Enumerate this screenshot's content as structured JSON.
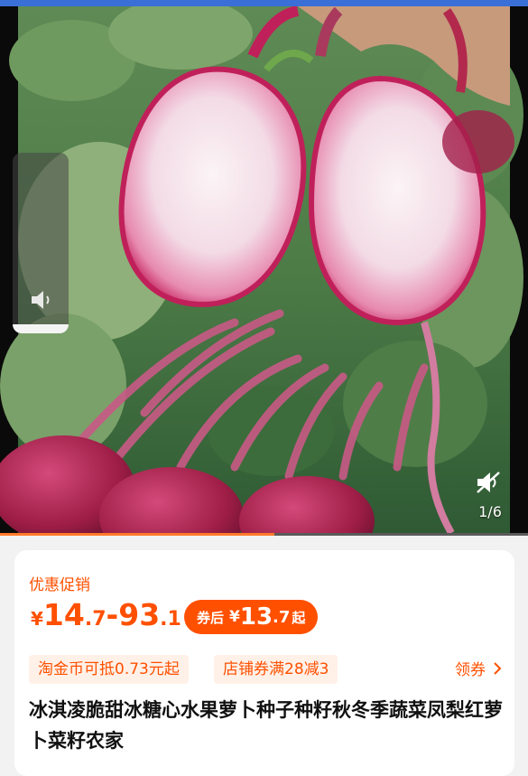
{
  "media": {
    "page_indicator": "1/6",
    "volume_level": 0.05,
    "progress": 0.52,
    "icons": [
      "speaker-icon",
      "mute-icon"
    ],
    "colors": {
      "radish": "#c7265f",
      "flesh": "#f6eaf0",
      "leaf": "#3e8a45"
    }
  },
  "promo": {
    "label": "优惠促销",
    "price": {
      "currency": "¥",
      "low_int": "14",
      "low_dec": ".7",
      "dash": "-",
      "high_int": "93",
      "high_dec": ".1"
    },
    "after_coupon": {
      "label": "券后",
      "currency": "¥",
      "int": "13",
      "dec": ".7",
      "suffix": "起"
    },
    "accent_color": "#ff5000"
  },
  "tags": {
    "coin": "淘金币可抵0.73元起",
    "shop_coupon": "店铺券满28减3"
  },
  "claim": {
    "label": "领券",
    "icon": "chevron-right-icon"
  },
  "product": {
    "title": "冰淇凌脆甜冰糖心水果萝卜种子种籽秋冬季蔬菜凤梨红萝卜菜籽农家"
  }
}
